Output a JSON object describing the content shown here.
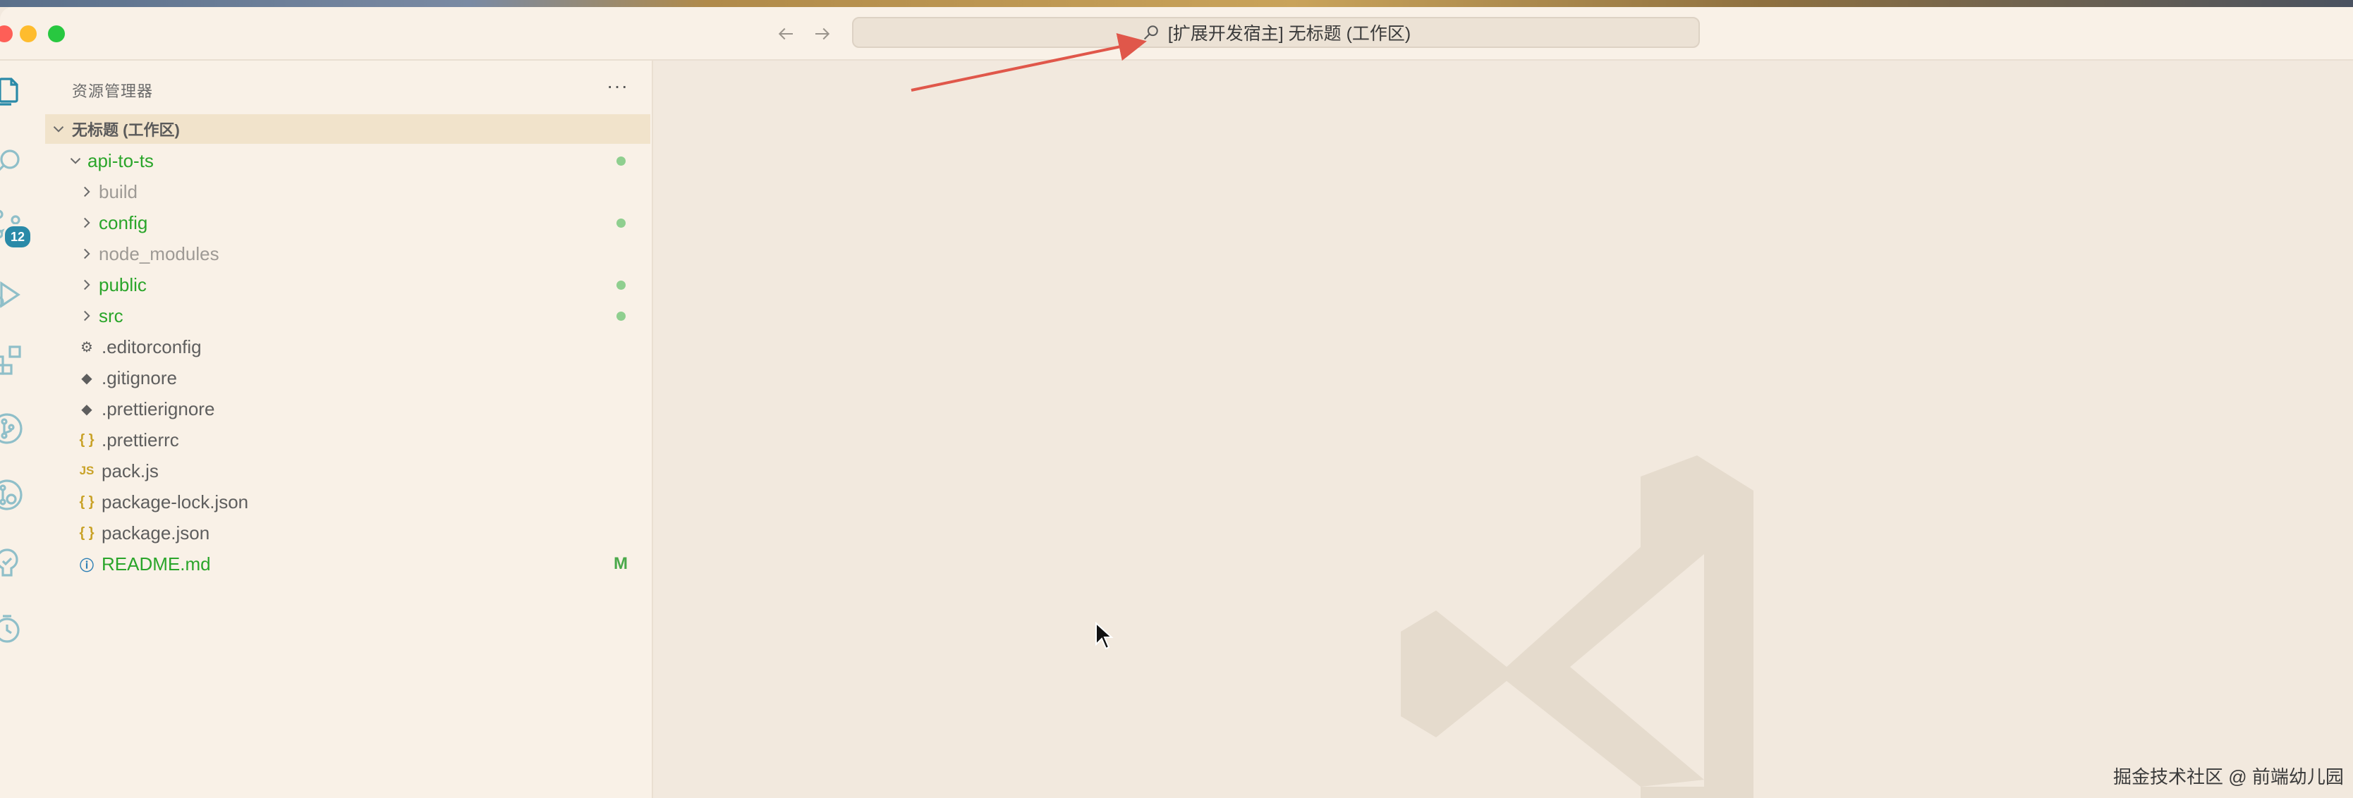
{
  "window": {
    "command_center": "[扩展开发宿主] 无标题 (工作区)"
  },
  "activity_bar": {
    "items": [
      "explorer",
      "search",
      "source-control",
      "run-debug",
      "extensions",
      "git-graph",
      "gitlens",
      "testing",
      "timeline"
    ],
    "source_control_badge": "12"
  },
  "sidebar": {
    "title": "资源管理器",
    "more_label": "···",
    "workspace_label": "无标题 (工作区)",
    "root_folder": "api-to-ts",
    "entries": [
      {
        "name": "build",
        "kind": "folder",
        "color": "gray",
        "status": ""
      },
      {
        "name": "config",
        "kind": "folder",
        "color": "green",
        "status": "dot"
      },
      {
        "name": "node_modules",
        "kind": "folder",
        "color": "gray",
        "status": ""
      },
      {
        "name": "public",
        "kind": "folder",
        "color": "green",
        "status": "dot"
      },
      {
        "name": "src",
        "kind": "folder",
        "color": "green",
        "status": "dot"
      },
      {
        "name": ".editorconfig",
        "kind": "file",
        "icon": "gear-icon",
        "color": "dark",
        "status": ""
      },
      {
        "name": ".gitignore",
        "kind": "file",
        "icon": "git-icon",
        "color": "dark",
        "status": ""
      },
      {
        "name": ".prettierignore",
        "kind": "file",
        "icon": "git-icon",
        "color": "dark",
        "status": ""
      },
      {
        "name": ".prettierrc",
        "kind": "file",
        "icon": "braces-icon",
        "color": "dark",
        "status": ""
      },
      {
        "name": "pack.js",
        "kind": "file",
        "icon": "js-icon",
        "color": "dark",
        "status": ""
      },
      {
        "name": "package-lock.json",
        "kind": "file",
        "icon": "braces-icon",
        "color": "dark",
        "status": ""
      },
      {
        "name": "package.json",
        "kind": "file",
        "icon": "braces-icon",
        "color": "dark",
        "status": ""
      },
      {
        "name": "README.md",
        "kind": "file",
        "icon": "info-icon",
        "color": "green",
        "status": "M"
      }
    ],
    "icon_glyphs": {
      "js": "JS",
      "braces": "{ }",
      "gear": "⚙",
      "git": "◆",
      "info": "ⓘ"
    }
  },
  "footer": {
    "watermark_text": "掘金技术社区 @ 前端幼儿园"
  },
  "colors": {
    "accent": "#2a8aa8",
    "modified_green": "#2aa52a",
    "annotation_arrow": "#e0574a"
  }
}
